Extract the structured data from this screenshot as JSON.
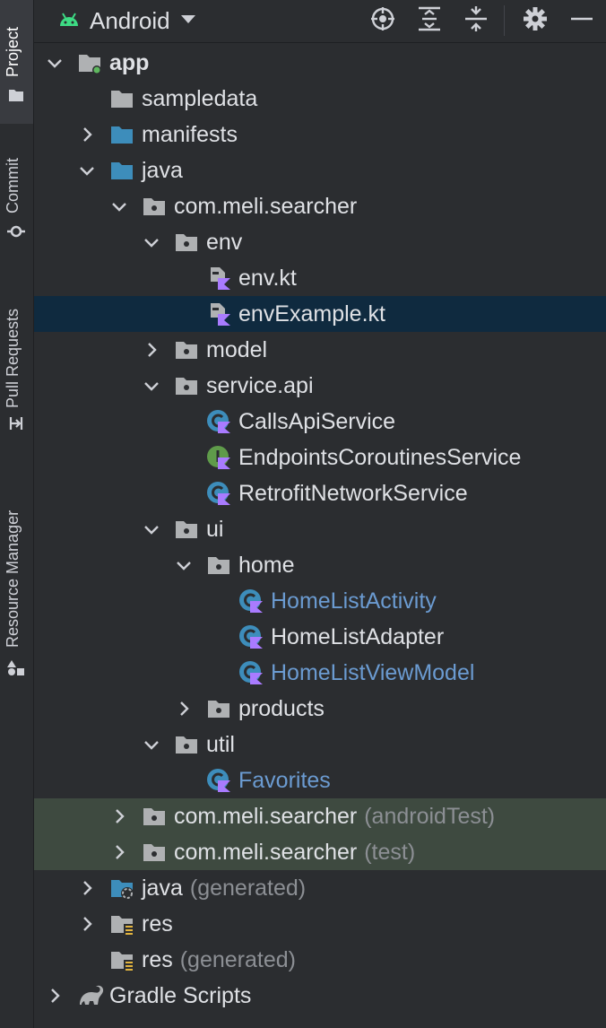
{
  "sidebar": {
    "tabs": [
      {
        "label": "Project",
        "icon": "folder-icon",
        "active": true
      },
      {
        "label": "Commit",
        "icon": "commit-icon",
        "active": false
      },
      {
        "label": "Pull Requests",
        "icon": "pull-request-icon",
        "active": false
      },
      {
        "label": "Resource Manager",
        "icon": "resource-manager-icon",
        "active": false
      }
    ]
  },
  "toolbar": {
    "view_label": "Android",
    "icons": [
      "locate-icon",
      "expand-all-icon",
      "collapse-all-icon",
      "gear-icon",
      "hide-icon"
    ]
  },
  "tree": [
    {
      "label": "app",
      "level": 0,
      "arrow": "down",
      "icon": "module-icon",
      "bold": true
    },
    {
      "label": "sampledata",
      "level": 1,
      "arrow": "none",
      "icon": "folder-icon"
    },
    {
      "label": "manifests",
      "level": 1,
      "arrow": "right",
      "icon": "folder-blue-icon"
    },
    {
      "label": "java",
      "level": 1,
      "arrow": "down",
      "icon": "folder-blue-icon"
    },
    {
      "label": "com.meli.searcher",
      "level": 2,
      "arrow": "down",
      "icon": "package-icon"
    },
    {
      "label": "env",
      "level": 3,
      "arrow": "down",
      "icon": "package-icon"
    },
    {
      "label": "env.kt",
      "level": 4,
      "arrow": "none",
      "icon": "kotlin-file-icon"
    },
    {
      "label": "envExample.kt",
      "level": 4,
      "arrow": "none",
      "icon": "kotlin-file-icon",
      "selected": true
    },
    {
      "label": "model",
      "level": 3,
      "arrow": "right",
      "icon": "package-icon"
    },
    {
      "label": "service.api",
      "level": 3,
      "arrow": "down",
      "icon": "package-icon"
    },
    {
      "label": "CallsApiService",
      "level": 4,
      "arrow": "none",
      "icon": "kotlin-class-icon"
    },
    {
      "label": "EndpointsCoroutinesService",
      "level": 4,
      "arrow": "none",
      "icon": "kotlin-interface-icon"
    },
    {
      "label": "RetrofitNetworkService",
      "level": 4,
      "arrow": "none",
      "icon": "kotlin-class-icon"
    },
    {
      "label": "ui",
      "level": 3,
      "arrow": "down",
      "icon": "package-icon"
    },
    {
      "label": "home",
      "level": 4,
      "arrow": "down",
      "icon": "package-icon"
    },
    {
      "label": "HomeListActivity",
      "level": 5,
      "arrow": "none",
      "icon": "kotlin-class-icon",
      "link": true
    },
    {
      "label": "HomeListAdapter",
      "level": 5,
      "arrow": "none",
      "icon": "kotlin-class-icon"
    },
    {
      "label": "HomeListViewModel",
      "level": 5,
      "arrow": "none",
      "icon": "kotlin-class-icon",
      "link": true
    },
    {
      "label": "products",
      "level": 4,
      "arrow": "right",
      "icon": "package-icon"
    },
    {
      "label": "util",
      "level": 3,
      "arrow": "down",
      "icon": "package-icon"
    },
    {
      "label": "Favorites",
      "level": 4,
      "arrow": "none",
      "icon": "kotlin-class-icon",
      "link": true
    },
    {
      "label": "com.meli.searcher",
      "suffix": "(androidTest)",
      "level": 2,
      "arrow": "right",
      "icon": "package-icon",
      "testbg": true
    },
    {
      "label": "com.meli.searcher",
      "suffix": "(test)",
      "level": 2,
      "arrow": "right",
      "icon": "package-icon",
      "testbg": true
    },
    {
      "label": "java",
      "suffix": "(generated)",
      "level": 1,
      "arrow": "right",
      "icon": "generated-folder-icon"
    },
    {
      "label": "res",
      "level": 1,
      "arrow": "right",
      "icon": "resource-folder-icon"
    },
    {
      "label": "res",
      "suffix": "(generated)",
      "level": 1,
      "arrow": "none",
      "icon": "resource-folder-icon"
    },
    {
      "label": "Gradle Scripts",
      "level": 0,
      "arrow": "right",
      "icon": "gradle-icon"
    }
  ]
}
